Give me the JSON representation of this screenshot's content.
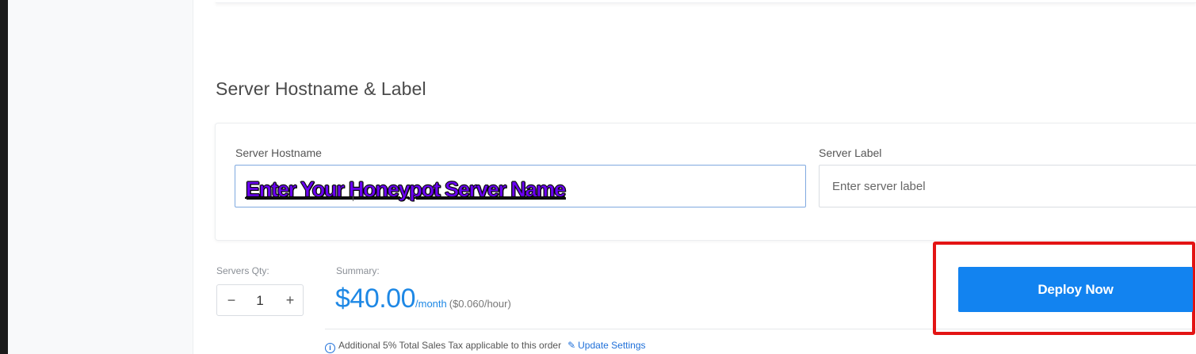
{
  "section": {
    "title": "Server Hostname & Label"
  },
  "hostname": {
    "label": "Server Hostname",
    "value": "",
    "overlay_text": "Enter Your Honeypot Server Name"
  },
  "server_label": {
    "label": "Server Label",
    "placeholder": "Enter server label"
  },
  "quantity": {
    "label": "Servers Qty:",
    "value": "1",
    "minus_symbol": "−",
    "plus_symbol": "+"
  },
  "summary": {
    "label": "Summary:",
    "price": "$40.00",
    "period": "/month",
    "hourly": "($0.060/hour)"
  },
  "tax": {
    "note": "Additional 5% Total Sales Tax applicable to this order",
    "update_link": "Update Settings",
    "info_icon": "info-icon",
    "pencil_icon": "pencil-icon"
  },
  "deploy": {
    "label": "Deploy Now"
  },
  "colors": {
    "accent": "#1283f0",
    "price": "#1e88e5",
    "highlight": "#e31414",
    "overlay_text": "#6a00f4"
  }
}
